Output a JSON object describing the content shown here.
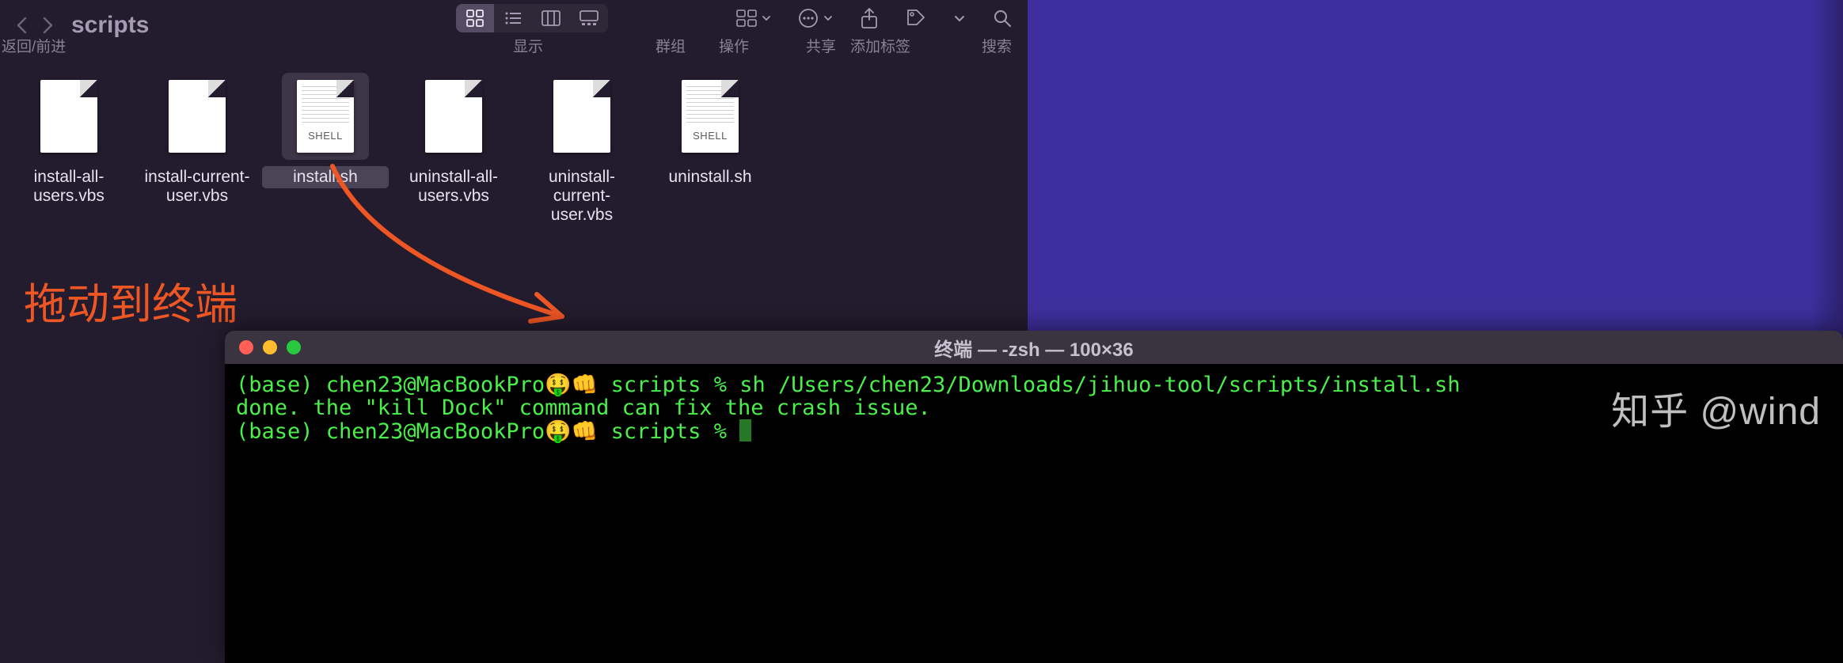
{
  "finder": {
    "nav_back_forward_label": "返回/前进",
    "title": "scripts",
    "view_label": "显示",
    "group_label": "群组",
    "action_label": "操作",
    "share_label": "共享",
    "tag_label": "添加标签",
    "search_label": "搜索"
  },
  "files": [
    {
      "name": "install-all-users.vbs",
      "type": "plain"
    },
    {
      "name": "install-current-user.vbs",
      "type": "plain"
    },
    {
      "name": "install.sh",
      "type": "shell",
      "selected": true
    },
    {
      "name": "uninstall-all-users.vbs",
      "type": "plain"
    },
    {
      "name": "uninstall-current-user.vbs",
      "type": "plain"
    },
    {
      "name": "uninstall.sh",
      "type": "shell"
    }
  ],
  "annotation": {
    "text": "拖动到终端"
  },
  "terminal": {
    "title": "终端 — -zsh — 100×36",
    "prompt_prefix": "(base) chen23@MacBookPro",
    "prompt_emoji": "🤑👊",
    "prompt_dir": "scripts",
    "command": "sh /Users/chen23/Downloads/jihuo-tool/scripts/install.sh",
    "output_line": "done. the \"kill Dock\" command can fix the crash issue."
  },
  "watermark": "知乎 @wind"
}
